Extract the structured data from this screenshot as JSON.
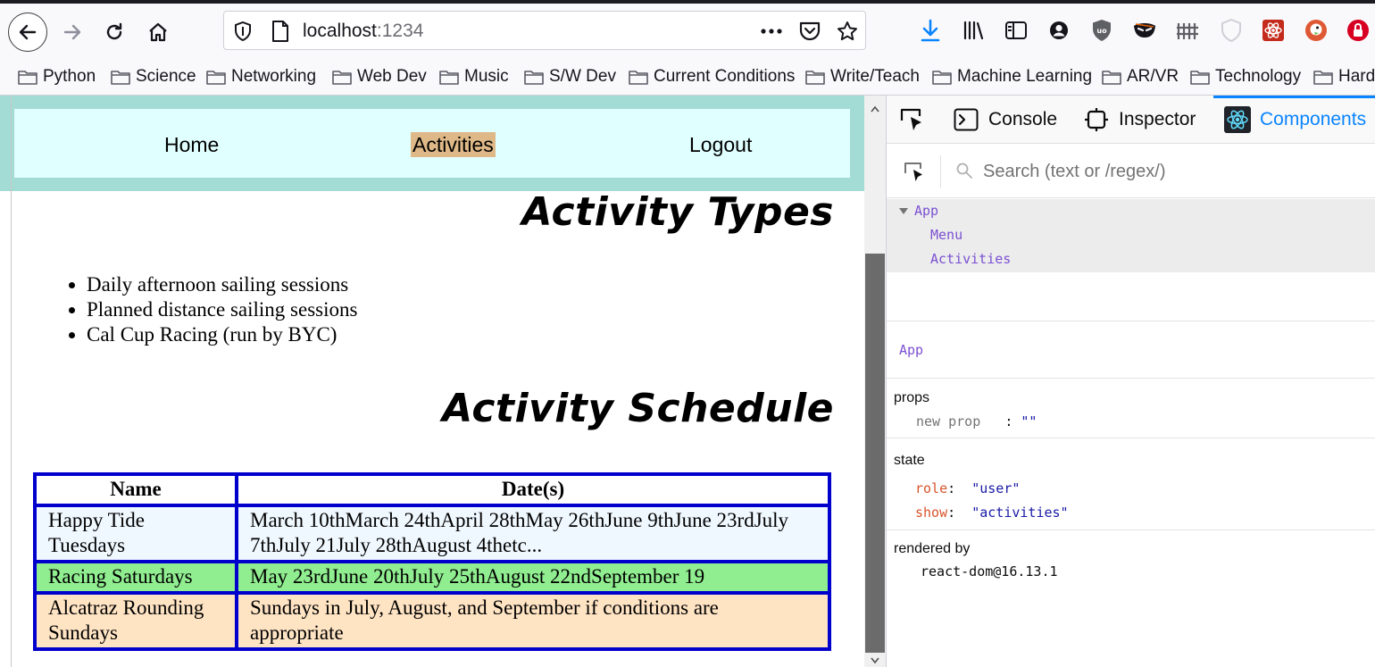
{
  "browser": {
    "url_host": "localhost",
    "url_port": ":1234",
    "bookmarks": [
      "Python",
      "Science",
      "Networking",
      "Web Dev",
      "Music",
      "S/W Dev",
      "Current Conditions",
      "Write/Teach",
      "Machine Learning",
      "AR/VR",
      "Technology",
      "Hard"
    ]
  },
  "navbar": {
    "home": "Home",
    "activities": "Activities",
    "logout": "Logout"
  },
  "page": {
    "types_heading": "Activity Types",
    "activity_types": [
      "Daily afternoon sailing sessions",
      "Planned distance sailing sessions",
      "Cal Cup Racing (run by BYC)"
    ],
    "schedule_heading": "Activity Schedule",
    "schedule": {
      "headers": [
        "Name",
        "Date(s)"
      ],
      "rows": [
        {
          "name": "Happy Tide Tuesdays",
          "dates": "March 10thMarch 24thApril 28thMay 26thJune 9thJune 23rdJuly 7thJuly 21July 28thAugust 4thetc...",
          "bg": "#f0f8ff"
        },
        {
          "name": "Racing Saturdays",
          "dates": "May 23rdJune 20thJuly 25thAugust 22ndSeptember 19",
          "bg": "#90ee90"
        },
        {
          "name": "Alcatraz Rounding Sundays",
          "dates": "Sundays in July, August, and September if conditions are appropriate",
          "bg": "#ffe4c4"
        }
      ]
    }
  },
  "devtools": {
    "tabs": {
      "console": "Console",
      "inspector": "Inspector",
      "components": "Components"
    },
    "search_placeholder": "Search (text or /regex/)",
    "tree": {
      "app": "App",
      "menu": "Menu",
      "activities": "Activities"
    },
    "selected": "App",
    "props_title": "props",
    "props": {
      "key": "new prop",
      "colon": ":",
      "value": "\"\""
    },
    "state_title": "state",
    "state": [
      {
        "key": "role",
        "value": "\"user\""
      },
      {
        "key": "show",
        "value": "\"activities\""
      }
    ],
    "rendered_by_title": "rendered by",
    "rendered_by_value": "react-dom@16.13.1"
  },
  "colors": {
    "navbar_outer": "#a3dcd4",
    "navbar_inner": "#e0ffff",
    "active_nav": "#deb887",
    "table_border": "#0000cd",
    "devtools_accent": "#0a84ff"
  }
}
